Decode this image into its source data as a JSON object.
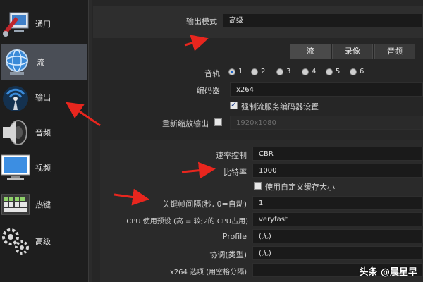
{
  "sidebar": {
    "items": [
      {
        "label": "通用",
        "icon": "general-settings-icon"
      },
      {
        "label": "流",
        "icon": "stream-globe-icon"
      },
      {
        "label": "输出",
        "icon": "output-signal-icon"
      },
      {
        "label": "音频",
        "icon": "speaker-icon"
      },
      {
        "label": "视频",
        "icon": "monitor-icon"
      },
      {
        "label": "热键",
        "icon": "keyboard-icon"
      },
      {
        "label": "高级",
        "icon": "gears-icon"
      }
    ],
    "active_index": 1
  },
  "output_mode": {
    "label": "输出模式",
    "value": "高级"
  },
  "tabs": [
    "流",
    "录像",
    "音频"
  ],
  "active_tab": "流",
  "audio_track": {
    "label": "音轨",
    "options": [
      "1",
      "2",
      "3",
      "4",
      "5",
      "6"
    ],
    "selected": "1"
  },
  "encoder": {
    "label": "编码器",
    "value": "x264"
  },
  "force_encoder_settings": {
    "label": "强制流服务编码器设置",
    "checked": true
  },
  "rescale": {
    "label": "重新缩放输出",
    "checked": false,
    "value": "1920x1080"
  },
  "rate_control": {
    "label": "速率控制",
    "value": "CBR"
  },
  "bitrate": {
    "label": "比特率",
    "value": "1000"
  },
  "custom_buffer": {
    "label": "使用自定义缓存大小",
    "checked": false
  },
  "keyframe_interval": {
    "label": "关键帧间隔(秒, 0=自动)",
    "value": "1"
  },
  "cpu_preset": {
    "label": "CPU 使用预设 (高 = 较少的 CPU占用)",
    "value": "veryfast"
  },
  "profile": {
    "label": "Profile",
    "value": "(无)"
  },
  "tune": {
    "label": "协调(类型)",
    "value": "(无)"
  },
  "x264_options": {
    "label": "x264 选项 (用空格分隔)",
    "value": ""
  },
  "watermark": "头条 @晨星早",
  "colors": {
    "annotation_arrow": "#e8261e",
    "accent_radio": "#1a64c8"
  }
}
